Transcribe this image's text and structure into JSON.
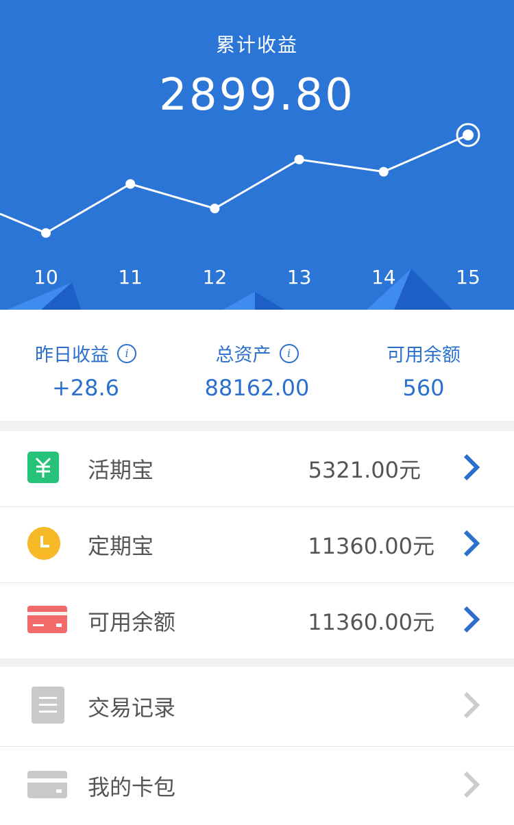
{
  "header": {
    "title": "累计收益",
    "total": "2899.80"
  },
  "chart_data": {
    "type": "line",
    "categories": [
      "10",
      "11",
      "12",
      "13",
      "14",
      "15"
    ],
    "series": [
      {
        "values": [
          1,
          3,
          2,
          4,
          3.5,
          5
        ]
      }
    ],
    "highlight_index": 5,
    "grid": false
  },
  "stats": [
    {
      "label": "昨日收益",
      "value": "+28.6",
      "has_info": true
    },
    {
      "label": "总资产",
      "value": "88162.00",
      "has_info": true
    },
    {
      "label": "可用余额",
      "value": "560",
      "has_info": false
    }
  ],
  "accounts": [
    {
      "label": "活期宝",
      "value": "5321.00元",
      "icon": "yuan-icon",
      "color": "#27c27a"
    },
    {
      "label": "定期宝",
      "value": "11360.00元",
      "icon": "clock-icon",
      "color": "#f7b928"
    },
    {
      "label": "可用余额",
      "value": "11360.00元",
      "icon": "credit-card-icon",
      "color": "#f46a6a"
    }
  ],
  "links": [
    {
      "label": "交易记录",
      "icon": "document-icon"
    },
    {
      "label": "我的卡包",
      "icon": "card-wallet-icon"
    }
  ],
  "colors": {
    "primary": "#2a75d6",
    "chevron_active": "#2b70cc",
    "chevron_inactive": "#cccccc"
  }
}
